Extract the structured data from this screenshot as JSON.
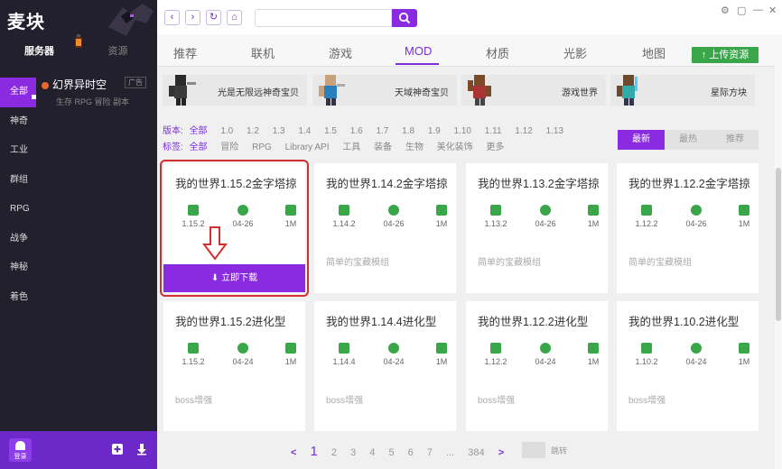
{
  "app": {
    "brand": "麦块"
  },
  "sidebar": {
    "top_tabs": [
      {
        "label": "服务器"
      },
      {
        "label": "资源"
      }
    ],
    "categories": [
      {
        "label": "全部"
      },
      {
        "label": "神奇"
      },
      {
        "label": "工业"
      },
      {
        "label": "群组"
      },
      {
        "label": "RPG"
      },
      {
        "label": "战争"
      },
      {
        "label": "神秘"
      },
      {
        "label": "着色"
      }
    ],
    "server": {
      "title": "幻界异时空",
      "badge": "广告",
      "tags": "生存 RPG 冒险 副本"
    },
    "login_label": "登录"
  },
  "topbar": {
    "search_placeholder": "",
    "window_controls": [
      "⚙",
      "▢",
      "—",
      "✕"
    ]
  },
  "tabs": [
    {
      "label": "推荐"
    },
    {
      "label": "联机"
    },
    {
      "label": "游戏"
    },
    {
      "label": "MOD"
    },
    {
      "label": "材质"
    },
    {
      "label": "光影"
    },
    {
      "label": "地图"
    }
  ],
  "upload_label": "上传资源",
  "featured": [
    {
      "label": "光是无限远神奇宝贝"
    },
    {
      "label": "天域神奇宝贝"
    },
    {
      "label": "游戏世界"
    },
    {
      "label": "星际方块"
    }
  ],
  "filters": {
    "version_label": "版本:",
    "versions": [
      "全部",
      "1.0",
      "1.2",
      "1.3",
      "1.4",
      "1.5",
      "1.6",
      "1.7",
      "1.8",
      "1.9",
      "1.10",
      "1.11",
      "1.12",
      "1.13"
    ],
    "tag_label": "标签:",
    "tags": [
      "全部",
      "冒险",
      "RPG",
      "Library API",
      "工具",
      "装备",
      "生物",
      "美化装饰",
      "更多"
    ]
  },
  "sort": [
    {
      "label": "最新"
    },
    {
      "label": "最热"
    },
    {
      "label": "推荐"
    }
  ],
  "cards": [
    {
      "title": "我的世界1.15.2金字塔掠",
      "version": "1.15.2",
      "date": "04-26",
      "size": "1M",
      "desc": ""
    },
    {
      "title": "我的世界1.14.2金字塔掠",
      "version": "1.14.2",
      "date": "04-26",
      "size": "1M",
      "desc": "简单的宝藏模组"
    },
    {
      "title": "我的世界1.13.2金字塔掠",
      "version": "1.13.2",
      "date": "04-26",
      "size": "1M",
      "desc": "简单的宝藏模组"
    },
    {
      "title": "我的世界1.12.2金字塔掠",
      "version": "1.12.2",
      "date": "04-26",
      "size": "1M",
      "desc": "简单的宝藏模组"
    },
    {
      "title": "我的世界1.15.2进化型",
      "version": "1.15.2",
      "date": "04-24",
      "size": "1M",
      "desc": "boss增强"
    },
    {
      "title": "我的世界1.14.4进化型",
      "version": "1.14.4",
      "date": "04-24",
      "size": "1M",
      "desc": "boss增强"
    },
    {
      "title": "我的世界1.12.2进化型",
      "version": "1.12.2",
      "date": "04-24",
      "size": "1M",
      "desc": "boss增强"
    },
    {
      "title": "我的世界1.10.2进化型",
      "version": "1.10.2",
      "date": "04-24",
      "size": "1M",
      "desc": "boss增强"
    }
  ],
  "download_label": "立即下载",
  "pager": {
    "prev": "<",
    "pages": [
      "1",
      "2",
      "3",
      "4",
      "5",
      "6",
      "7",
      "...",
      "384"
    ],
    "next": ">",
    "jump_label": "跳转"
  },
  "colors": {
    "accent": "#8a2be2",
    "green": "#3aa64a",
    "sidebar": "#23202d",
    "highlight": "#d32f2f"
  }
}
